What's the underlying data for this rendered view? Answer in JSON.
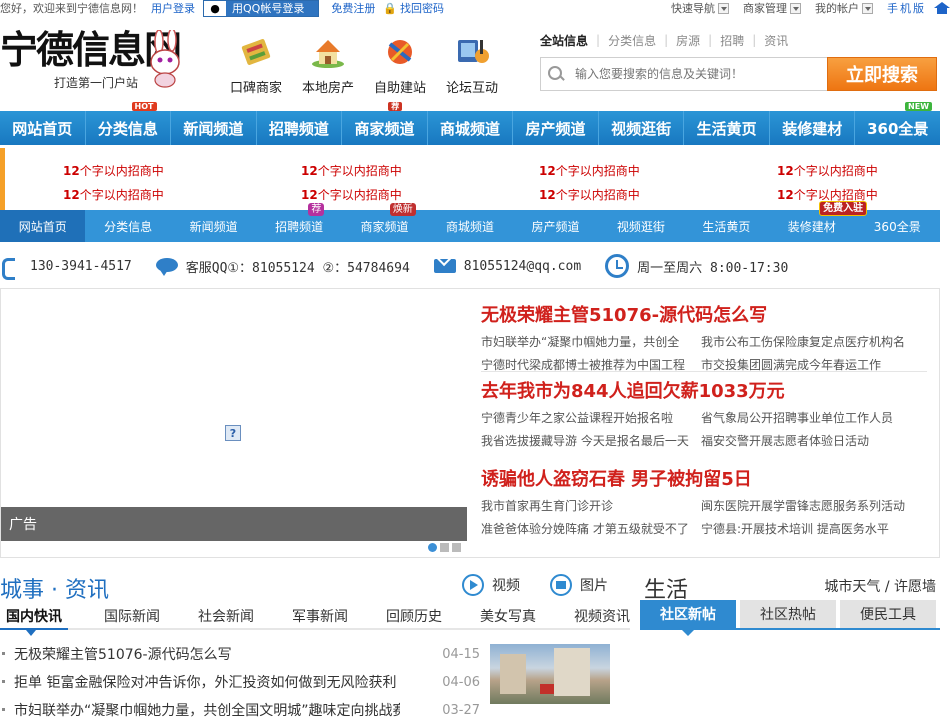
{
  "topbar": {
    "greeting": "您好，欢迎来到宁德信息网！",
    "login": "用户登录",
    "qq_login": "用QQ帐号登录",
    "register": "免费注册",
    "find_password": "找回密码",
    "quick_nav": "快速导航",
    "merchant_manage": "商家管理",
    "my_account": "我的帐户",
    "mobile": "手机版"
  },
  "logo": {
    "title": "宁德信息网",
    "slogan": "打造第一门户站"
  },
  "header_icons": [
    {
      "label": "口碑商家",
      "icon": "book-icon"
    },
    {
      "label": "本地房产",
      "icon": "house-icon"
    },
    {
      "label": "自助建站",
      "icon": "build-icon"
    },
    {
      "label": "论坛互动",
      "icon": "forum-icon"
    }
  ],
  "search": {
    "tabs": [
      "全站信息",
      "分类信息",
      "房源",
      "招聘",
      "资讯"
    ],
    "placeholder": "输入您要搜索的信息及关键词！",
    "button": "立即搜索"
  },
  "main_nav": [
    {
      "label": "网站首页"
    },
    {
      "label": "分类信息",
      "badge": "HOT"
    },
    {
      "label": "新闻频道"
    },
    {
      "label": "招聘频道"
    },
    {
      "label": "商家频道",
      "badge": "荐"
    },
    {
      "label": "商城频道"
    },
    {
      "label": "房产频道"
    },
    {
      "label": "视频逛街"
    },
    {
      "label": "生活黄页"
    },
    {
      "label": "装修建材"
    },
    {
      "label": "360全景",
      "badge": "NEW"
    }
  ],
  "ad_text": {
    "num": "12",
    "rest": "个字以内招商中"
  },
  "sub_nav": [
    {
      "label": "网站首页"
    },
    {
      "label": "分类信息"
    },
    {
      "label": "新闻频道"
    },
    {
      "label": "招聘频道",
      "badge": "荐"
    },
    {
      "label": "商家频道",
      "badge": "焕新"
    },
    {
      "label": "商城频道"
    },
    {
      "label": "房产频道"
    },
    {
      "label": "视频逛街"
    },
    {
      "label": "生活黄页"
    },
    {
      "label": "装修建材",
      "badge": "免费入驻"
    },
    {
      "label": "360全景"
    }
  ],
  "contact": {
    "phone": "130-3941-4517",
    "qq": "客服QQ①：81055124 ②：54784694",
    "email": "81055124@qq.com",
    "hours": "周一至周六 8:00-17:30"
  },
  "slide": {
    "caption": "广告",
    "qmark": "?"
  },
  "headlines": [
    {
      "title": "无极荣耀主管51076-源代码怎么写",
      "links": [
        "市妇联举办“凝聚巾帼她力量，共创全",
        "我市公布工伤保险康复定点医疗机构名",
        "宁德时代梁成都博士被推荐为中国工程",
        "市交投集团圆满完成今年春运工作"
      ]
    },
    {
      "title": "去年我市为844人追回欠薪1033万元",
      "links": [
        "宁德青少年之家公益课程开始报名啦",
        "省气象局公开招聘事业单位工作人员",
        "我省选拔援藏导游 今天是报名最后一天",
        "福安交警开展志愿者体验日活动"
      ]
    },
    {
      "title": "诱骗他人盗窃石春 男子被拘留5日",
      "links": [
        "我市首家再生育门诊开诊",
        "闽东医院开展学雷锋志愿服务系列活动",
        "准爸爸体验分娩阵痛 才第五级就受不了",
        "宁德县:开展技术培训 提高医务水平"
      ]
    }
  ],
  "city": {
    "title": "城事 · 资讯",
    "video": "视频",
    "picture": "图片",
    "tabs": [
      "国内快讯",
      "国际新闻",
      "社会新闻",
      "军事新闻",
      "回顾历史",
      "美女写真",
      "视频资讯"
    ],
    "items": [
      {
        "title": "无极荣耀主管51076-源代码怎么写",
        "date": "04-15"
      },
      {
        "title": "拒单 钜富金融保险对冲告诉你，外汇投资如何做到无风险获利",
        "date": "04-06"
      },
      {
        "title": "市妇联举办“凝聚巾帼她力量，共创全国文明城”趣味定向挑战赛",
        "date": "03-27"
      }
    ]
  },
  "life": {
    "title": "生活",
    "links": "城市天气 / 许愿墙",
    "tabs": [
      "社区新帖",
      "社区热帖",
      "便民工具"
    ]
  }
}
